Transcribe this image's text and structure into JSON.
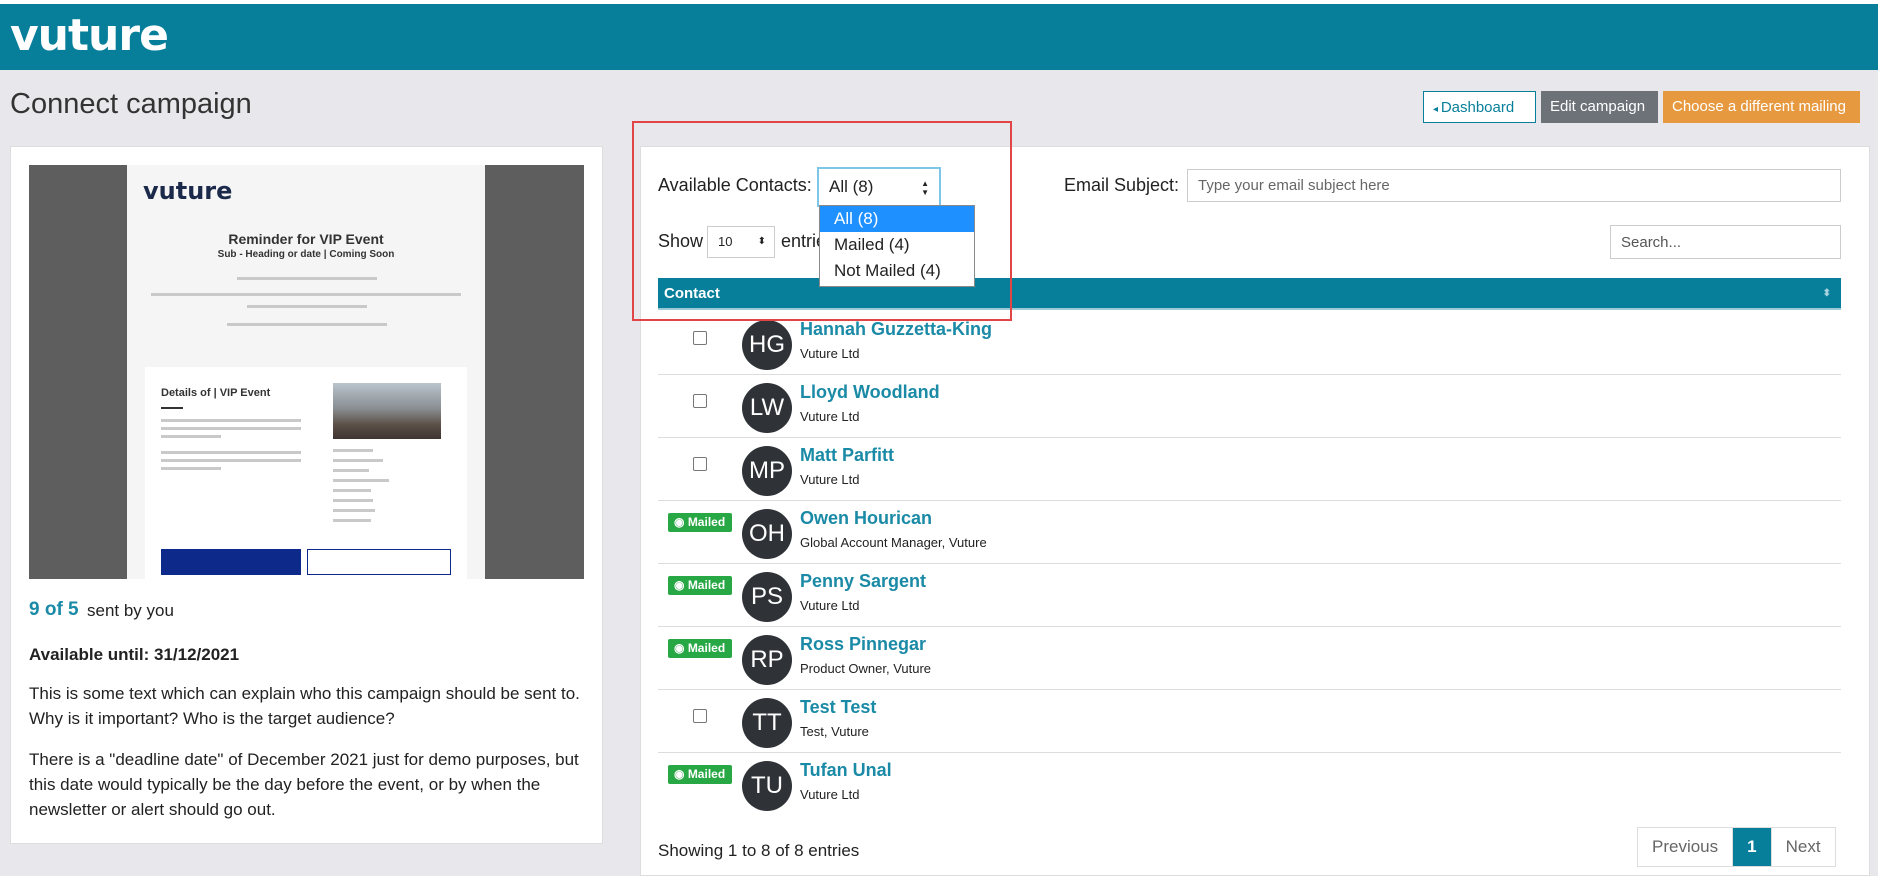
{
  "brand": {
    "logo": "vuture",
    "topbar_color": "#087f9a"
  },
  "page": {
    "title": "Connect campaign"
  },
  "header_buttons": {
    "dashboard": "Dashboard",
    "edit": "Edit campaign",
    "choose": "Choose a different mailing"
  },
  "left": {
    "preview": {
      "logo": "vuture",
      "title": "Reminder for VIP Event",
      "subtitle": "Sub - Heading or date | Coming Soon",
      "details_heading": "Details of | VIP Event"
    },
    "sent_count": "9 of 5",
    "sent_text": "sent by you",
    "available_until": "Available until: 31/12/2021",
    "para1": "This is some text which can explain who this campaign should be sent to.  Why is it important?  Who is the target audience?",
    "para2": "There is a \"deadline date\" of December 2021 just for demo purposes, but this date would typically be the day before the event, or by when the newsletter or alert should go out."
  },
  "filters": {
    "available_label": "Available Contacts:",
    "available_selected": "All (8)",
    "options": [
      "All (8)",
      "Mailed (4)",
      "Not Mailed (4)"
    ],
    "email_subject_label": "Email Subject:",
    "email_subject_placeholder": "Type your email subject here",
    "show_label": "Show",
    "show_value": "10",
    "entries_label": "entries",
    "search_placeholder": "Search..."
  },
  "table": {
    "header": "Contact",
    "badge_label": "Mailed",
    "rows": [
      {
        "initials": "HG",
        "name": "Hannah Guzzetta-King",
        "sub": "Vuture Ltd",
        "mailed": false
      },
      {
        "initials": "LW",
        "name": "Lloyd Woodland",
        "sub": "Vuture Ltd",
        "mailed": false
      },
      {
        "initials": "MP",
        "name": "Matt Parfitt",
        "sub": "Vuture Ltd",
        "mailed": false
      },
      {
        "initials": "OH",
        "name": "Owen Hourican",
        "sub": "Global Account Manager, Vuture",
        "mailed": true
      },
      {
        "initials": "PS",
        "name": "Penny Sargent",
        "sub": "Vuture Ltd",
        "mailed": true
      },
      {
        "initials": "RP",
        "name": "Ross Pinnegar",
        "sub": "Product Owner, Vuture",
        "mailed": true
      },
      {
        "initials": "TT",
        "name": "Test Test",
        "sub": "Test, Vuture",
        "mailed": false
      },
      {
        "initials": "TU",
        "name": "Tufan Unal",
        "sub": "Vuture Ltd",
        "mailed": true
      }
    ]
  },
  "footer": {
    "showing": "Showing 1 to 8 of 8 entries",
    "previous": "Previous",
    "page": "1",
    "next": "Next"
  }
}
